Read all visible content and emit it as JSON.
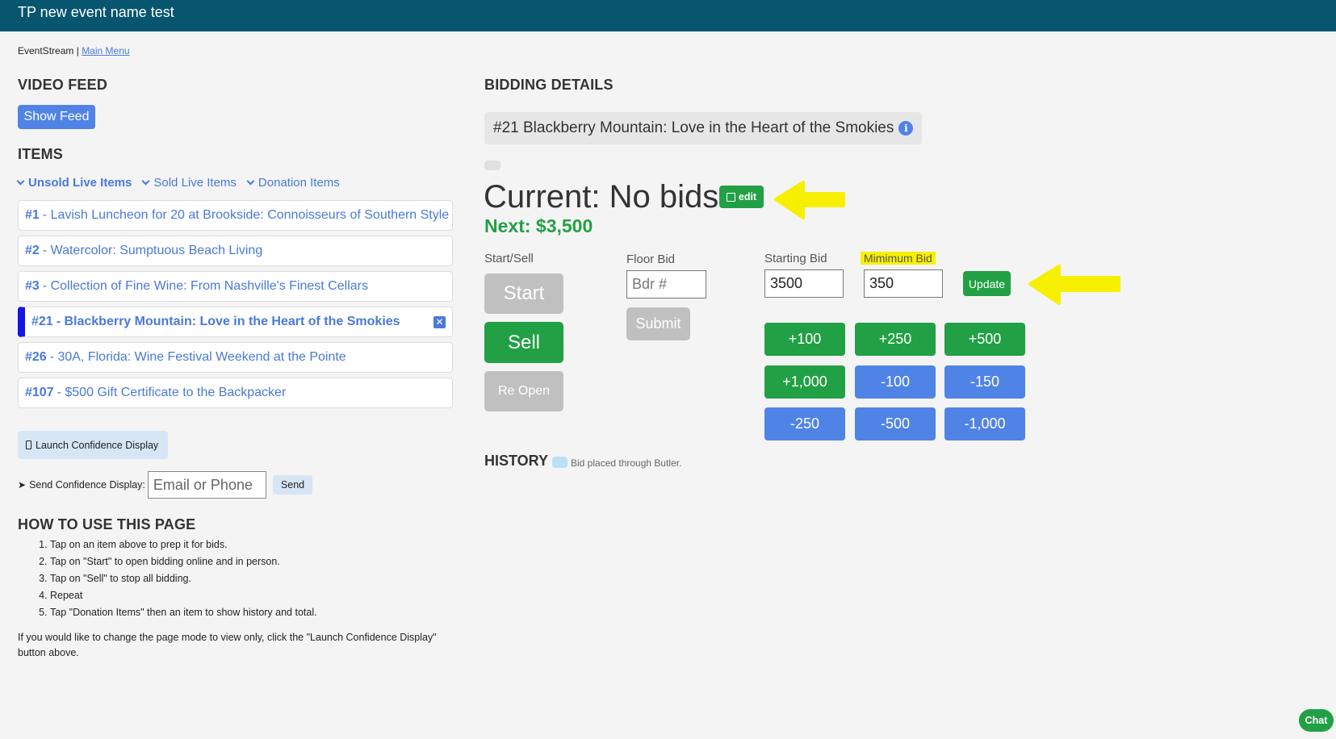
{
  "header": {
    "title": "TP new event name test"
  },
  "breadcrumb": {
    "app": "EventStream",
    "separator": "|",
    "main_menu": "Main Menu"
  },
  "video_feed": {
    "heading": "VIDEO FEED",
    "show_feed_label": "Show Feed"
  },
  "items": {
    "heading": "ITEMS",
    "tabs": [
      {
        "label": "Unsold Live Items",
        "active": true
      },
      {
        "label": "Sold Live Items",
        "active": false
      },
      {
        "label": "Donation Items",
        "active": false
      }
    ],
    "list": [
      {
        "num": "#1",
        "title": "- Lavish Luncheon for 20 at Brookside: Connoisseurs of Southern Style"
      },
      {
        "num": "#2",
        "title": "- Watercolor: Sumptuous Beach Living"
      },
      {
        "num": "#3",
        "title": "- Collection of Fine Wine: From Nashville's Finest Cellars"
      },
      {
        "num": "#21",
        "title": "- Blackberry Mountain: Love in the Heart of the Smokies",
        "active": true
      },
      {
        "num": "#26",
        "title": "- 30A, Florida: Wine Festival Weekend at the Pointe"
      },
      {
        "num": "#107",
        "title": "- $500 Gift Certificate to the Backpacker"
      }
    ],
    "remove_icon": "close-icon"
  },
  "confidence": {
    "launch_label": "Launch Confidence Display",
    "send_label": "Send Confidence Display:",
    "input_placeholder": "Email or Phone",
    "send_button": "Send"
  },
  "howto": {
    "heading": "HOW TO USE THIS PAGE",
    "steps": [
      "Tap on an item above to prep it for bids.",
      "Tap on \"Start\" to open bidding online and in person.",
      "Tap on \"Sell\" to stop all bidding.",
      "Repeat",
      "Tap \"Donation Items\" then an item to show history and total."
    ],
    "note": "If you would like to change the page mode to view only, click the \"Launch Confidence Display\" button above."
  },
  "bidding": {
    "heading": "BIDDING DETAILS",
    "item_title": "#21 Blackberry Mountain: Love in the Heart of the Smokies",
    "current": "Current: No bids",
    "edit_label": "edit",
    "next": "Next: $3,500",
    "start_sell_label": "Start/Sell",
    "start_label": "Start",
    "sell_label": "Sell",
    "reopen_label": "Re Open",
    "floor_bid_label": "Floor Bid",
    "floor_bid_placeholder": "Bdr #",
    "submit_label": "Submit",
    "starting_bid_label": "Starting Bid",
    "starting_bid_value": "3500",
    "minimum_bid_label": "Mimimum Bid",
    "minimum_bid_value": "350",
    "update_label": "Update",
    "increments": [
      "+100",
      "+250",
      "+500",
      "+1,000",
      "-100",
      "-150",
      "-250",
      "-500",
      "-1,000"
    ]
  },
  "history": {
    "heading": "HISTORY",
    "legend": "Bid placed through Butler."
  },
  "chat": {
    "label": "Chat"
  },
  "colors": {
    "header": "#07556f",
    "accent_blue": "#5083e6",
    "accent_green": "#22a045",
    "highlight": "#f7f000",
    "active_item": "#1515e6"
  }
}
